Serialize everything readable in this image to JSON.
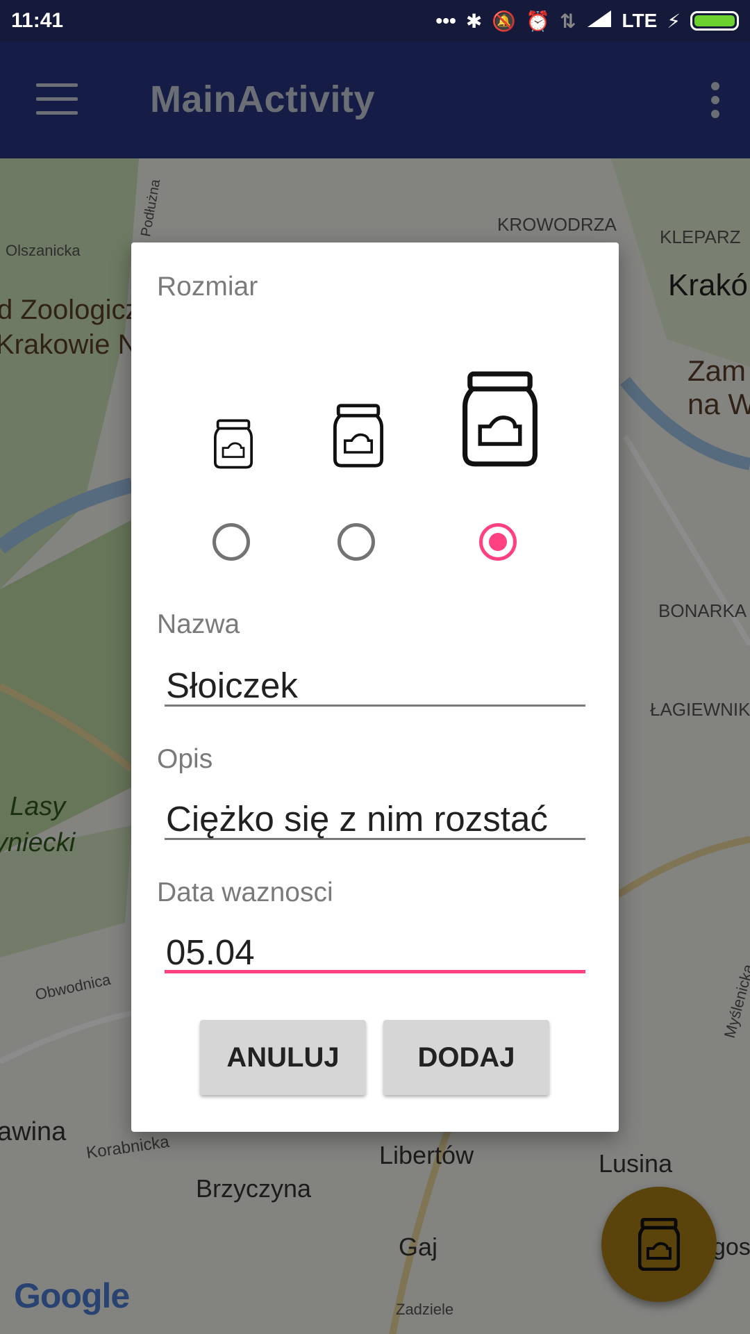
{
  "status_bar": {
    "time": "11:41",
    "network": "LTE",
    "icons": [
      "more-dots-icon",
      "bluetooth-icon",
      "vibrate-off-icon",
      "alarm-icon",
      "data-arrows-icon",
      "signal-icon",
      "charging-icon",
      "battery-icon"
    ],
    "battery_color": "#6bd12f"
  },
  "app_bar": {
    "title": "MainActivity",
    "background": "#273480"
  },
  "map": {
    "labels": [
      "KROWODRZA",
      "KLEPARZ",
      "Krakó",
      "Olszanicka",
      "Podłużna",
      "d Zoologicz",
      "Krakowie N",
      "Zam",
      "na W",
      "BONARKA",
      "ŁAGIEWNIKI",
      "Lasy",
      "yniecki",
      "Obwodnica",
      "awina",
      "Korabnicka",
      "Libertów",
      "Brzyczyna",
      "Lusina",
      "Gaj",
      "Zadziele",
      "Myślenicka",
      "gosz"
    ],
    "attribution": "Google"
  },
  "dialog": {
    "size_label": "Rozmiar",
    "sizes": [
      {
        "icon": "jar-small-icon",
        "selected": false
      },
      {
        "icon": "jar-medium-icon",
        "selected": false
      },
      {
        "icon": "jar-large-icon",
        "selected": true
      }
    ],
    "name_label": "Nazwa",
    "name_value": "Słoiczek",
    "desc_label": "Opis",
    "desc_value": "Ciężko się z nim rozstać",
    "expiry_label": "Data waznosci",
    "expiry_value": "05.04",
    "cancel_label": "ANULUJ",
    "add_label": "DODAJ",
    "accent_color": "#ff4081"
  },
  "fab": {
    "icon": "jar-icon",
    "color": "#a57d15"
  }
}
